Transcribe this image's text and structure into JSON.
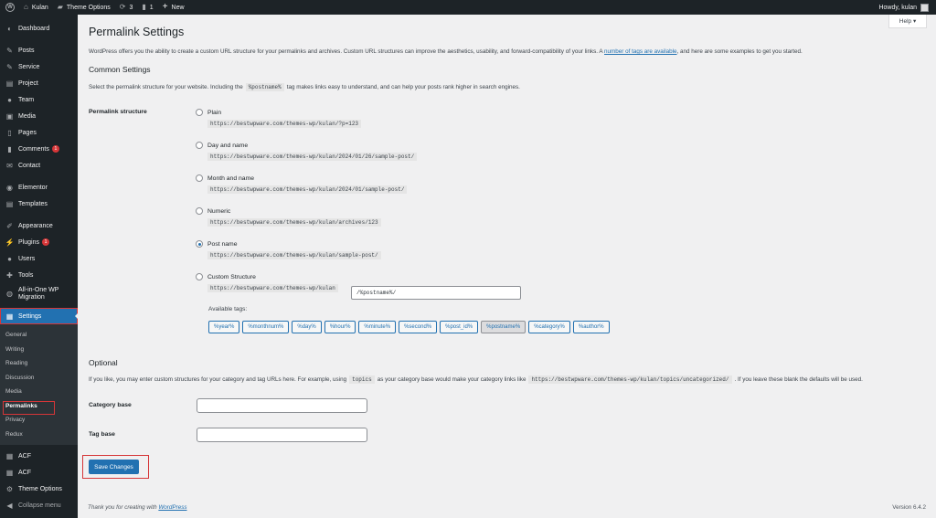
{
  "adminbar": {
    "site_name": "Kulan",
    "theme_options": "Theme Options",
    "updates_count": "3",
    "comments_count": "1",
    "new_label": "New",
    "howdy": "Howdy, kulan",
    "icons": [
      "wordpress-logo-icon",
      "home-icon",
      "theme-options-icon",
      "updates-icon",
      "comments-icon",
      "plus-icon"
    ]
  },
  "sidebar": {
    "items": [
      {
        "label": "Dashboard",
        "icon": "dashboard-icon"
      },
      {
        "label": "Posts",
        "icon": "pin-icon"
      },
      {
        "label": "Service",
        "icon": "service-icon"
      },
      {
        "label": "Project",
        "icon": "project-icon"
      },
      {
        "label": "Team",
        "icon": "team-icon"
      },
      {
        "label": "Media",
        "icon": "media-icon"
      },
      {
        "label": "Pages",
        "icon": "pages-icon"
      },
      {
        "label": "Comments",
        "icon": "comments-icon",
        "badge": "1"
      },
      {
        "label": "Contact",
        "icon": "mail-icon"
      },
      {
        "label": "Elementor",
        "icon": "elementor-icon"
      },
      {
        "label": "Templates",
        "icon": "templates-icon"
      },
      {
        "label": "Appearance",
        "icon": "brush-icon"
      },
      {
        "label": "Plugins",
        "icon": "plugin-icon",
        "badge": "1"
      },
      {
        "label": "Users",
        "icon": "users-icon"
      },
      {
        "label": "Tools",
        "icon": "wrench-icon"
      },
      {
        "label_line1": "All-in-One WP",
        "label_line2": "Migration",
        "icon": "migration-icon"
      },
      {
        "label": "Settings",
        "icon": "settings-icon"
      },
      {
        "label": "ACF",
        "icon": "acf-icon"
      },
      {
        "label": "ACF",
        "icon": "acf-icon"
      },
      {
        "label": "Theme Options",
        "icon": "gear-icon"
      },
      {
        "label": "Collapse menu",
        "icon": "collapse-icon"
      }
    ],
    "submenu": [
      "General",
      "Writing",
      "Reading",
      "Discussion",
      "Media",
      "Permalinks",
      "Privacy",
      "Redux"
    ]
  },
  "main": {
    "help": "Help ▾",
    "title": "Permalink Settings",
    "intro_pre": "WordPress offers you the ability to create a custom URL structure for your permalinks and archives. Custom URL structures can improve the aesthetics, usability, and forward-compatibility of your links. A ",
    "intro_link": "number of tags are available",
    "intro_post": ", and here are some examples to get you started.",
    "common_heading": "Common Settings",
    "common_desc_pre": "Select the permalink structure for your website. Including the",
    "common_desc_code": "%postname%",
    "common_desc_post": "tag makes links easy to understand, and can help your posts rank higher in search engines.",
    "structure_label": "Permalink structure",
    "options": [
      {
        "label": "Plain",
        "example": "https://bestwpware.com/themes-wp/kulan/?p=123",
        "checked": false
      },
      {
        "label": "Day and name",
        "example": "https://bestwpware.com/themes-wp/kulan/2024/01/26/sample-post/",
        "checked": false
      },
      {
        "label": "Month and name",
        "example": "https://bestwpware.com/themes-wp/kulan/2024/01/sample-post/",
        "checked": false
      },
      {
        "label": "Numeric",
        "example": "https://bestwpware.com/themes-wp/kulan/archives/123",
        "checked": false
      },
      {
        "label": "Post name",
        "example": "https://bestwpware.com/themes-wp/kulan/sample-post/",
        "checked": true
      },
      {
        "label": "Custom Structure",
        "example": "https://bestwpware.com/themes-wp/kulan",
        "checked": false
      }
    ],
    "custom_value": "/%postname%/",
    "available_tags_label": "Available tags:",
    "tags": [
      "%year%",
      "%monthnum%",
      "%day%",
      "%hour%",
      "%minute%",
      "%second%",
      "%post_id%",
      "%postname%",
      "%category%",
      "%author%"
    ],
    "active_tag": "%postname%",
    "optional_heading": "Optional",
    "optional_desc_pre": "If you like, you may enter custom structures for your category and tag URLs here. For example, using",
    "optional_desc_code1": "topics",
    "optional_desc_mid": "as your category base would make your category links like",
    "optional_desc_code2": "https://bestwpware.com/themes-wp/kulan/topics/uncategorized/",
    "optional_desc_post": ". If you leave these blank the defaults will be used.",
    "category_base_label": "Category base",
    "category_base_value": "",
    "tag_base_label": "Tag base",
    "tag_base_value": "",
    "save_label": "Save Changes",
    "footer_text": "Thank you for creating with ",
    "footer_link": "WordPress",
    "version": "Version 6.4.2"
  },
  "colors": {
    "accent": "#2271b1",
    "sidebar_bg": "#1d2327",
    "highlight": "#d63638"
  }
}
